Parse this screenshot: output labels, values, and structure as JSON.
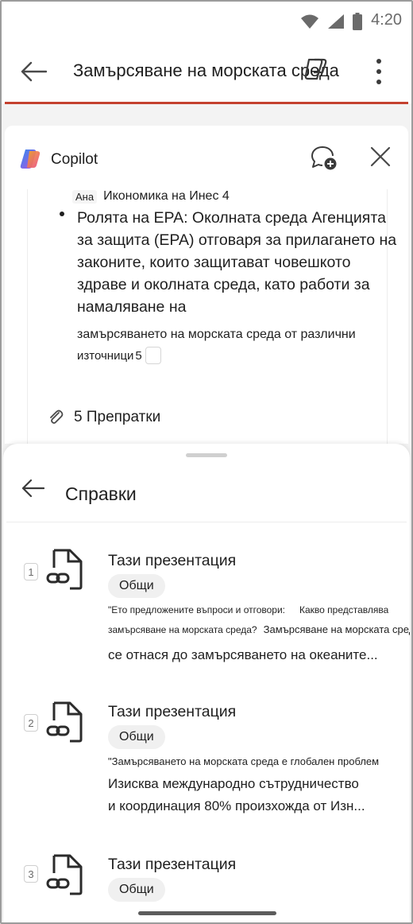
{
  "status": {
    "time": "4:20",
    "icons": [
      "wifi-icon",
      "signal-icon",
      "battery-icon"
    ]
  },
  "header": {
    "title": "Замърсяване на морската среда",
    "accent_color": "#c4412f"
  },
  "copilot": {
    "title": "Copilot",
    "cite_row": {
      "chip": "Ана",
      "text": "Икономика на Инес 4"
    },
    "bullet_text": "Ролята на EPA: Околната среда Агенцията за защита (EPA) отговаря за прилагането на законите, които защитават човешкото здраве и околната среда, като работи за намаляване на",
    "bullet_text_2": "замърсяването на морската среда от различни",
    "bullet_text_3": "източници",
    "bullet_cite": "5",
    "references_label": "5 Препратки"
  },
  "sheet": {
    "title": "Справки",
    "references": [
      {
        "number": "1",
        "title": "Тази презентация",
        "tag": "Общи",
        "lines": [
          {
            "a": "\"Ето предложените въпроси и отговори:",
            "b": "Какво представлява"
          },
          {
            "a": "замърсяване на морската среда?",
            "b": "Замърсяване на морската среда"
          },
          {
            "a": "се отнася до замърсяването на океаните..."
          }
        ]
      },
      {
        "number": "2",
        "title": "Тази презентация",
        "tag": "Общи",
        "lines": [
          {
            "a": "\"Замърсяването на морската среда е глобален проблем"
          },
          {
            "a": "Изисква международно сътрудничество"
          },
          {
            "a": "и координация 80% произхожда от Изн..."
          }
        ]
      },
      {
        "number": "3",
        "title": "Тази презентация",
        "tag": "Общи"
      }
    ]
  }
}
